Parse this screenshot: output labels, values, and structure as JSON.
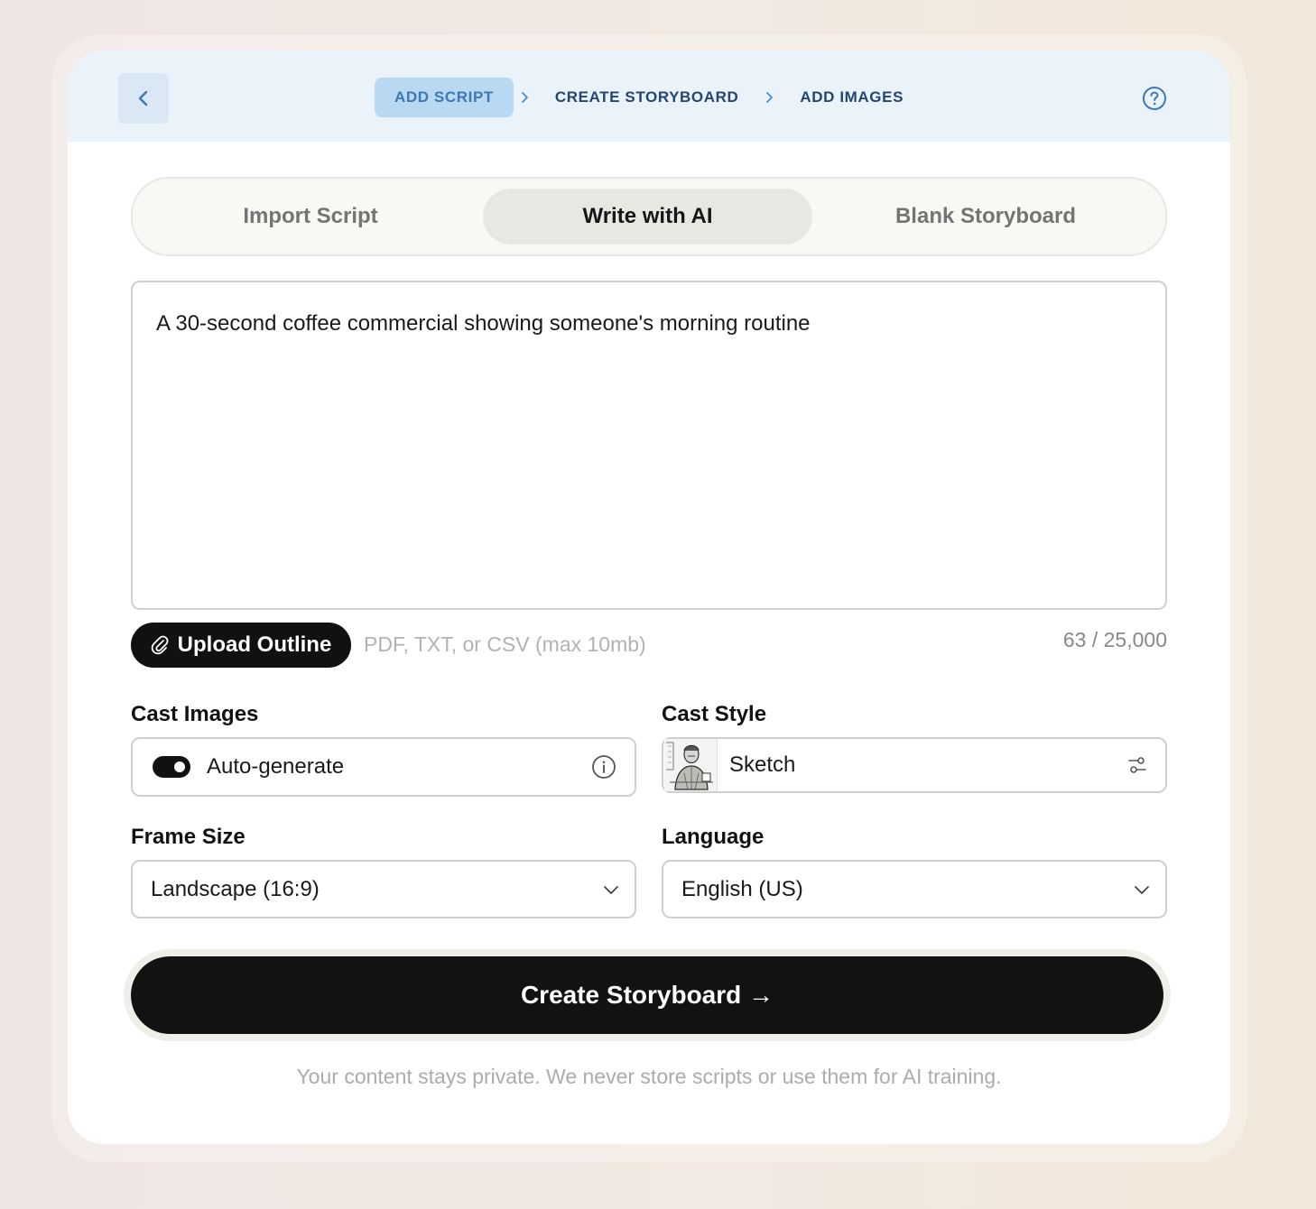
{
  "header": {
    "steps": [
      {
        "label": "ADD SCRIPT"
      },
      {
        "label": "CREATE STORYBOARD"
      },
      {
        "label": "ADD IMAGES"
      }
    ],
    "active_step_color": "#b9d8f2"
  },
  "mode_tabs": [
    {
      "label": "Import Script"
    },
    {
      "label": "Write with AI"
    },
    {
      "label": "Blank Storyboard"
    }
  ],
  "active_mode": "Write with AI",
  "prompt": {
    "value": "A 30-second coffee commercial showing someone's morning routine"
  },
  "upload": {
    "button_label": "Upload Outline",
    "hint": "PDF, TXT, or CSV (max 10mb)",
    "char_count": "63 / 25,000"
  },
  "cast_images": {
    "label": "Cast Images",
    "toggle_label": "Auto-generate",
    "toggle_on": true
  },
  "cast_style": {
    "label": "Cast Style",
    "value": "Sketch"
  },
  "frame_size": {
    "label": "Frame Size",
    "value": "Landscape (16:9)"
  },
  "language": {
    "label": "Language",
    "value": "English (US)"
  },
  "create_button": {
    "label": "Create Storyboard →"
  },
  "privacy_note": "Your content stays private. We never store scripts or use them for AI training.",
  "colors": {
    "header_bg": "#ebf3fa",
    "primary_button": "#121212",
    "step_text": "#23456f"
  },
  "icons": [
    "chevron-left-icon",
    "chevron-right-icon",
    "help-icon",
    "paperclip-icon",
    "info-icon",
    "sliders-icon",
    "chevron-down-icon",
    "arrow-right-icon"
  ]
}
